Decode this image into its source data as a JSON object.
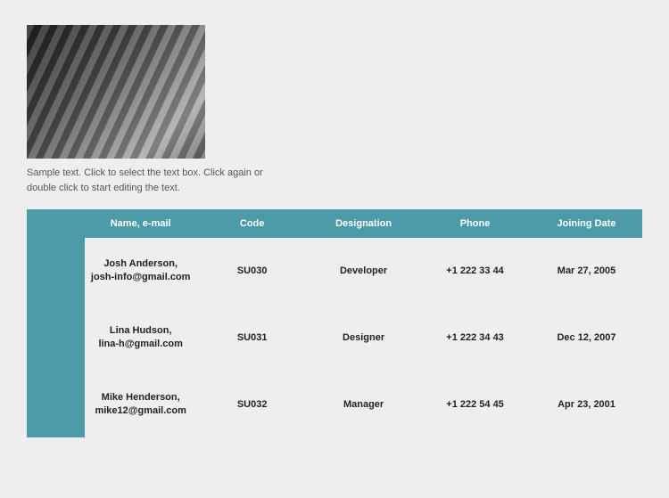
{
  "sample_text": "Sample text. Click to select the text box. Click again or double click to start editing the text.",
  "table": {
    "headers": [
      "Name, e-mail",
      "Code",
      "Designation",
      "Phone",
      "Joining Date"
    ],
    "rows": [
      {
        "name": "Josh Anderson,",
        "email": "josh-info@gmail.com",
        "code": "SU030",
        "designation": "Developer",
        "phone": "+1 222 33 44",
        "date": "Mar 27, 2005"
      },
      {
        "name": "Lina Hudson,",
        "email": "lina-h@gmail.com",
        "code": "SU031",
        "designation": "Designer",
        "phone": "+1 222 34 43",
        "date": "Dec 12, 2007"
      },
      {
        "name": "Mike Henderson,",
        "email": "mike12@gmail.com",
        "code": "SU032",
        "designation": "Manager",
        "phone": "+1 222 54 45",
        "date": "Apr 23, 2001"
      }
    ]
  }
}
